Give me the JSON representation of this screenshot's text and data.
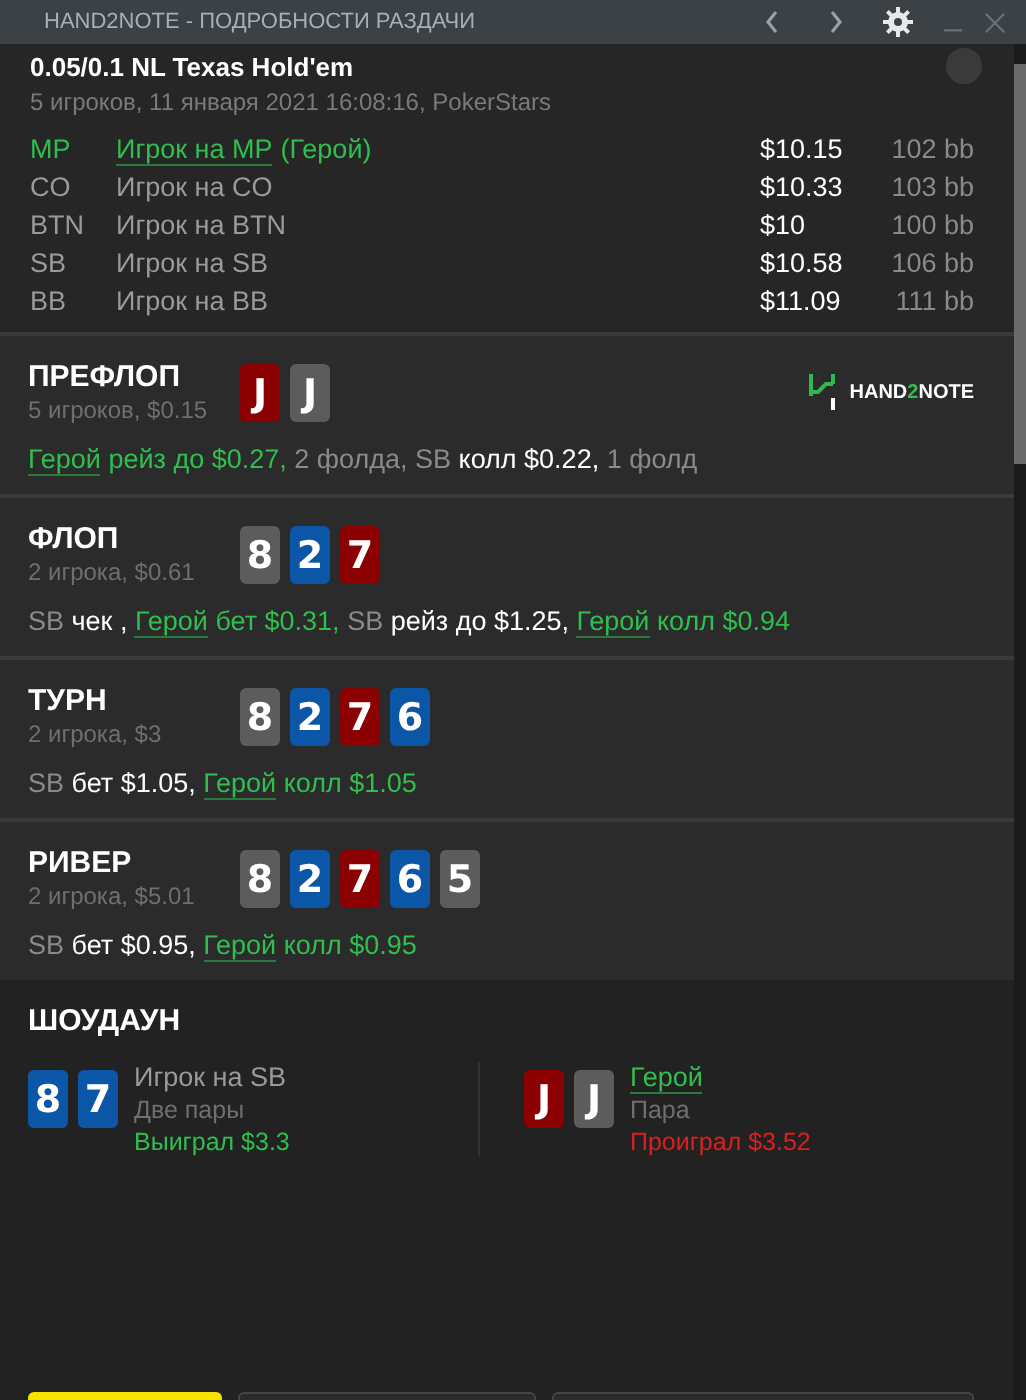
{
  "window": {
    "title": "HAND2NOTE - ПОДРОБНОСТИ РАЗДАЧИ"
  },
  "hand": {
    "title": "0.05/0.1 NL Texas Hold'em",
    "subtitle": "5 игроков, 11 января 2021 16:08:16, PokerStars"
  },
  "players": [
    {
      "position": "MP",
      "name": "Игрок на MP",
      "hero": true,
      "hero_tag": "(Герой)",
      "stack": "$10.15",
      "bb": "102 bb"
    },
    {
      "position": "CO",
      "name": "Игрок на CO",
      "hero": false,
      "stack": "$10.33",
      "bb": "103 bb"
    },
    {
      "position": "BTN",
      "name": "Игрок на BTN",
      "hero": false,
      "stack": "$10",
      "bb": "100 bb"
    },
    {
      "position": "SB",
      "name": "Игрок на SB",
      "hero": false,
      "stack": "$10.58",
      "bb": "106 bb"
    },
    {
      "position": "BB",
      "name": "Игрок на BB",
      "hero": false,
      "stack": "$11.09",
      "bb": "111 bb"
    }
  ],
  "logo": {
    "parts": [
      "HAND",
      "2",
      "NOTE"
    ]
  },
  "streets": [
    {
      "name": "ПРЕФЛОП",
      "info": "5 игроков, $0.15",
      "logo": true,
      "cards": [
        {
          "rank": "J",
          "color": "#8b0000"
        },
        {
          "rank": "J",
          "color": "#5c5c5c"
        }
      ],
      "actions": [
        {
          "kind": "hero",
          "text": "Герой"
        },
        {
          "kind": "hero_action",
          "text": " рейз до $0.27,"
        },
        {
          "kind": "muted",
          "text": " 2 фолда, SB"
        },
        {
          "kind": "action",
          "text": " колл $0.22,"
        },
        {
          "kind": "muted",
          "text": " 1 фолд"
        }
      ]
    },
    {
      "name": "ФЛОП",
      "info": "2 игрока, $0.61",
      "logo": false,
      "cards": [
        {
          "rank": "8",
          "color": "#5c5c5c"
        },
        {
          "rank": "2",
          "color": "#0b56a6"
        },
        {
          "rank": "7",
          "color": "#8b0000"
        }
      ],
      "actions": [
        {
          "kind": "muted",
          "text": "SB"
        },
        {
          "kind": "action",
          "text": " чек , "
        },
        {
          "kind": "hero",
          "text": "Герой"
        },
        {
          "kind": "hero_action",
          "text": " бет $0.31,"
        },
        {
          "kind": "muted",
          "text": " SB"
        },
        {
          "kind": "action",
          "text": " рейз до $1.25, "
        },
        {
          "kind": "hero",
          "text": "Герой"
        },
        {
          "kind": "hero_action",
          "text": " колл $0.94"
        }
      ]
    },
    {
      "name": "ТУРН",
      "info": "2 игрока, $3",
      "logo": false,
      "cards": [
        {
          "rank": "8",
          "color": "#5c5c5c"
        },
        {
          "rank": "2",
          "color": "#0b56a6"
        },
        {
          "rank": "7",
          "color": "#8b0000"
        },
        {
          "rank": "6",
          "color": "#0b56a6"
        }
      ],
      "actions": [
        {
          "kind": "muted",
          "text": "SB"
        },
        {
          "kind": "action",
          "text": " бет $1.05, "
        },
        {
          "kind": "hero",
          "text": "Герой"
        },
        {
          "kind": "hero_action",
          "text": " колл $1.05"
        }
      ]
    },
    {
      "name": "РИВЕР",
      "info": "2 игрока, $5.01",
      "logo": false,
      "cards": [
        {
          "rank": "8",
          "color": "#5c5c5c"
        },
        {
          "rank": "2",
          "color": "#0b56a6"
        },
        {
          "rank": "7",
          "color": "#8b0000"
        },
        {
          "rank": "6",
          "color": "#0b56a6"
        },
        {
          "rank": "5",
          "color": "#5c5c5c"
        }
      ],
      "actions": [
        {
          "kind": "muted",
          "text": "SB"
        },
        {
          "kind": "action",
          "text": " бет $0.95, "
        },
        {
          "kind": "hero",
          "text": "Герой"
        },
        {
          "kind": "hero_action",
          "text": " колл $0.95"
        }
      ]
    }
  ],
  "showdown": {
    "title": "ШОУДАУН",
    "hands": [
      {
        "player": "Игрок на SB",
        "hero": false,
        "combo": "Две пары",
        "result": "Выиграл $3.3",
        "won": true,
        "cards": [
          {
            "rank": "8",
            "color": "#0b56a6"
          },
          {
            "rank": "7",
            "color": "#0b56a6"
          }
        ]
      },
      {
        "player": "Герой",
        "hero": true,
        "combo": "Пара",
        "result": "Проиграл $3.52",
        "won": false,
        "cards": [
          {
            "rank": "J",
            "color": "#8b0000"
          },
          {
            "rank": "J",
            "color": "#5c5c5c"
          }
        ]
      }
    ]
  },
  "buttons": [
    {
      "kind": "primary"
    },
    {
      "kind": "secondary"
    },
    {
      "kind": "secondary"
    }
  ]
}
